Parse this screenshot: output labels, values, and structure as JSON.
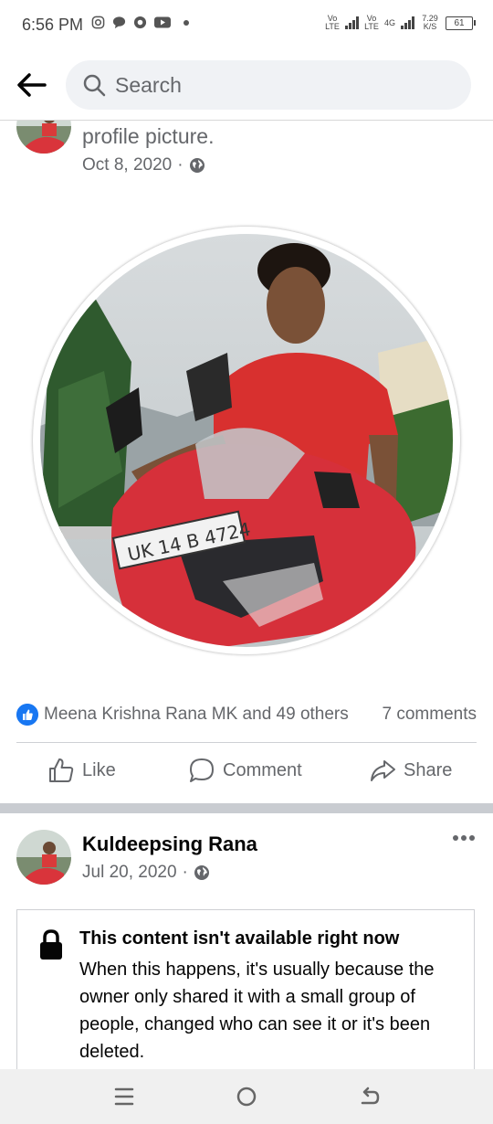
{
  "status_bar": {
    "time": "6:56 PM",
    "network1": "Vo LTE",
    "network2": "Vo LTE",
    "network3": "4G",
    "speed": "7.29 K/S",
    "battery": "61"
  },
  "search": {
    "placeholder": "Search"
  },
  "post1": {
    "text_fragment": "profile picture.",
    "date": "Oct 8, 2020",
    "reactions_text": "Meena Krishna Rana MK and 49 others",
    "comments_text": "7 comments",
    "actions": {
      "like": "Like",
      "comment": "Comment",
      "share": "Share"
    }
  },
  "post2": {
    "author": "Kuldeepsing Rana",
    "date": "Jul 20, 2020",
    "unavailable_title": "This content isn't available right now",
    "unavailable_body": "When this happens, it's usually because the owner only shared it with a small group of people, changed who can see it or it's been deleted."
  },
  "colors": {
    "accent": "#1877f2",
    "secondary_text": "#65676b",
    "divider": "#ced0d4"
  },
  "icons": [
    "back-arrow-icon",
    "search-icon",
    "globe-icon",
    "like-icon",
    "comment-icon",
    "share-icon",
    "more-icon",
    "lock-icon",
    "menu-icon",
    "home-icon",
    "back-nav-icon"
  ]
}
